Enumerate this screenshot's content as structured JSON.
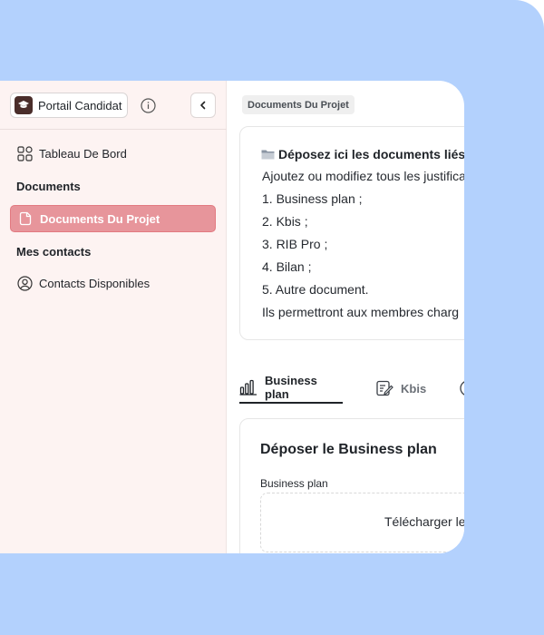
{
  "brand": {
    "label": "Portail Candidat",
    "logo_icon": "graduation-cap-icon"
  },
  "sidebar": {
    "dashboard": {
      "label": "Tableau De Bord",
      "icon": "grid-icon"
    },
    "section_documents": "Documents",
    "documents_projet": {
      "label": "Documents Du Projet",
      "icon": "file-icon"
    },
    "section_contacts": "Mes contacts",
    "contacts": {
      "label": "Contacts Disponibles",
      "icon": "user-circle-icon"
    }
  },
  "breadcrumb": "Documents Du Projet",
  "info": {
    "title": "Déposez ici les documents liés",
    "intro": "Ajoutez ou modifiez tous les justifica",
    "items": [
      "1. Business plan ;",
      "2. Kbis ;",
      "3. RIB Pro ;",
      "4. Bilan ;",
      "5. Autre document."
    ],
    "outro": "Ils permettront aux membres charg"
  },
  "tabs": [
    {
      "label": "Business plan",
      "icon": "bar-chart-icon",
      "active": true
    },
    {
      "label": "Kbis",
      "icon": "edit-document-icon",
      "active": false
    }
  ],
  "upload": {
    "title": "Déposer le Business plan",
    "field_label": "Business plan",
    "dropzone_text": "Télécharger le"
  },
  "colors": {
    "background": "#b3d1fd",
    "sidebar": "#fdf3f2",
    "active_item": "#e7959b"
  }
}
